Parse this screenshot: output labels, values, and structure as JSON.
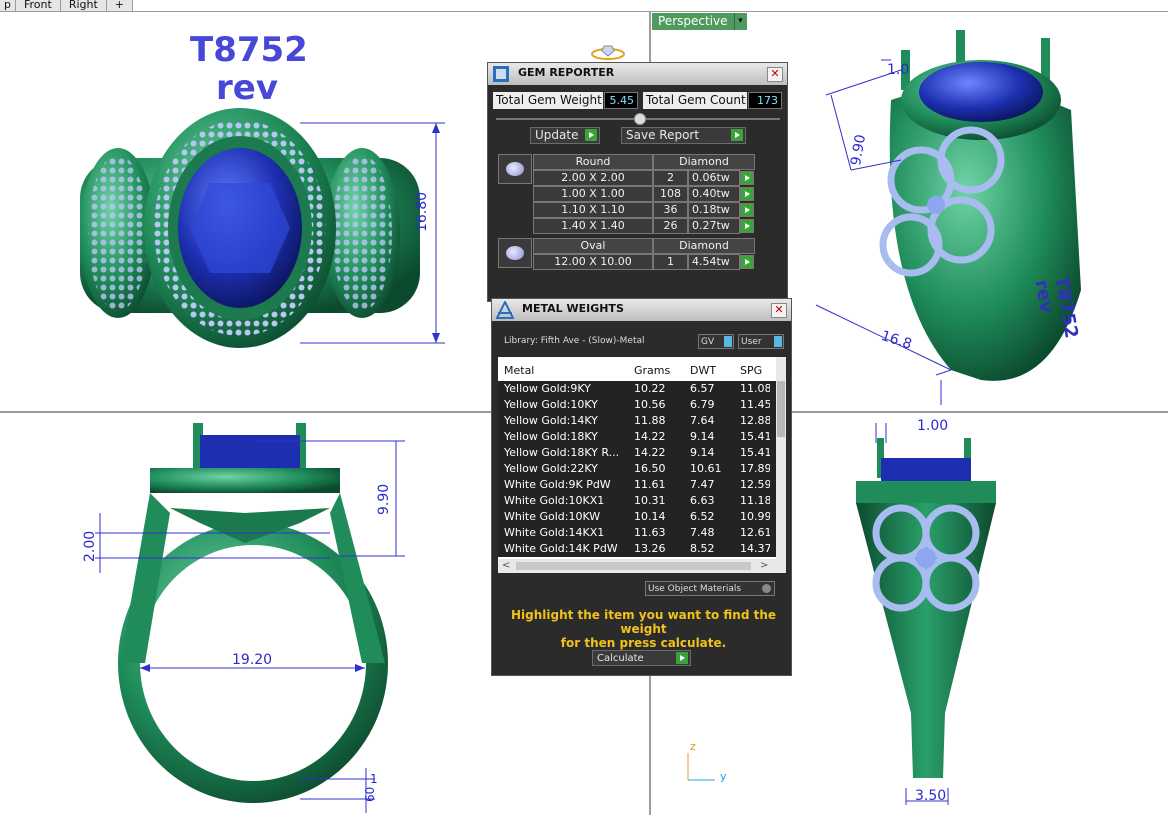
{
  "tabs": [
    "p",
    "Front",
    "Right",
    "+"
  ],
  "perspective": {
    "label": "Perspective",
    "dropdown": "▾"
  },
  "title": {
    "line1": "T8752",
    "line2": "rev"
  },
  "dims": {
    "top_view": "16.80",
    "persp_a": "1.0",
    "persp_b": "9.90",
    "persp_c": "16.8",
    "front_a": "9.90",
    "front_b": "2.00",
    "front_c": "19.20",
    "front_d": "1",
    "front_e": "60",
    "right_a": "1.00",
    "right_b": "3.50"
  },
  "persp_label": {
    "line1": "T8752",
    "line2": "rev"
  },
  "axis": {
    "z": "z",
    "y": "y"
  },
  "gem_reporter": {
    "title": "GEM REPORTER",
    "total_weight_label": "Total Gem Weight",
    "total_weight": "5.45",
    "total_count_label": "Total Gem Count",
    "total_count": "173",
    "update": "Update",
    "save": "Save Report",
    "groups": [
      {
        "shape": "Round",
        "material": "Diamond",
        "rows": [
          {
            "size": "2.00 X 2.00",
            "count": "2",
            "tw": "0.06tw"
          },
          {
            "size": "1.00 X 1.00",
            "count": "108",
            "tw": "0.40tw"
          },
          {
            "size": "1.10 X 1.10",
            "count": "36",
            "tw": "0.18tw"
          },
          {
            "size": "1.40 X 1.40",
            "count": "26",
            "tw": "0.27tw"
          }
        ]
      },
      {
        "shape": "Oval",
        "material": "Diamond",
        "rows": [
          {
            "size": "12.00 X 10.00",
            "count": "1",
            "tw": "4.54tw"
          }
        ]
      }
    ]
  },
  "metal_weights": {
    "title": "METAL WEIGHTS",
    "library": "Library: Fifth Ave - (Slow)-Metal",
    "gv": "GV",
    "user": "User",
    "headers": [
      "Metal",
      "Grams",
      "DWT",
      "SPG"
    ],
    "rows": [
      [
        "Yellow Gold:9KY",
        "10.22",
        "6.57",
        "11.08"
      ],
      [
        "Yellow Gold:10KY",
        "10.56",
        "6.79",
        "11.45"
      ],
      [
        "Yellow Gold:14KY",
        "11.88",
        "7.64",
        "12.88"
      ],
      [
        "Yellow Gold:18KY",
        "14.22",
        "9.14",
        "15.41"
      ],
      [
        "Yellow Gold:18KY R...",
        "14.22",
        "9.14",
        "15.41"
      ],
      [
        "Yellow Gold:22KY",
        "16.50",
        "10.61",
        "17.89"
      ],
      [
        "White Gold:9K PdW",
        "11.61",
        "7.47",
        "12.59"
      ],
      [
        "White Gold:10KX1",
        "10.31",
        "6.63",
        "11.18"
      ],
      [
        "White Gold:10KW",
        "10.14",
        "6.52",
        "10.99"
      ],
      [
        "White Gold:14KX1",
        "11.63",
        "7.48",
        "12.61"
      ],
      [
        "White Gold:14K PdW",
        "13.26",
        "8.52",
        "14.37"
      ]
    ],
    "use_object": "Use Object Materials",
    "hint_line1": "Highlight the item you want to find the weight",
    "hint_line2": "for then press calculate.",
    "calculate": "Calculate"
  }
}
